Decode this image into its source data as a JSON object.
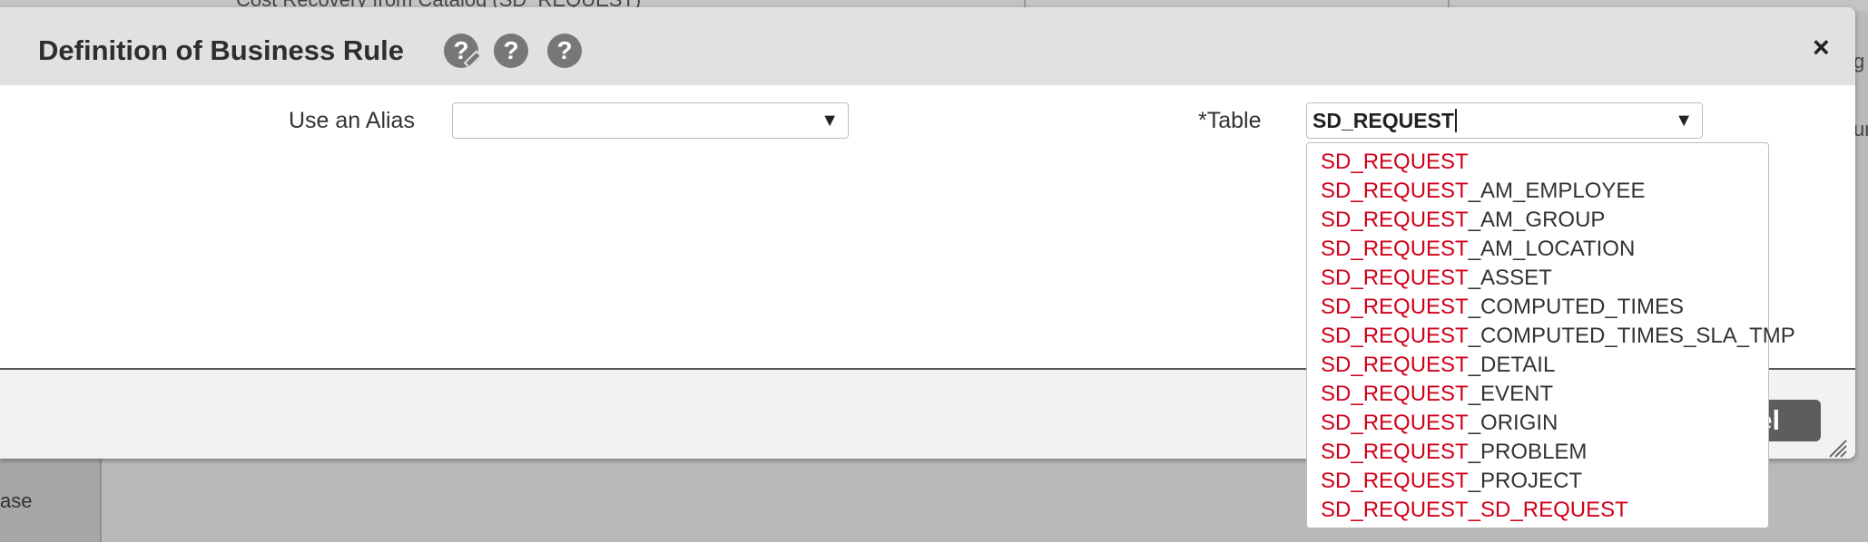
{
  "background": {
    "top_text": "Cost Recovery from Catalog (SD_REQUEST)",
    "left_text": "ase",
    "right_texts": [
      "g",
      "ur"
    ]
  },
  "modal": {
    "title": "Definition of Business Rule",
    "help_icons": [
      {
        "icon": "edit-help-icon",
        "glyph": "?"
      },
      {
        "icon": "help-icon",
        "glyph": "?"
      },
      {
        "icon": "help-icon",
        "glyph": "?"
      }
    ],
    "close_glyph": "×",
    "alias_label": "Use an Alias",
    "alias_value": "",
    "table_label": "*Table",
    "table_value": "SD_REQUEST",
    "select_arrow": "▼",
    "cancel_label": "Cancel",
    "cancel_visible": "cel"
  },
  "dropdown": {
    "match": "SD_REQUEST",
    "items": [
      {
        "match": "SD_REQUEST",
        "rest": ""
      },
      {
        "match": "SD_REQUEST",
        "rest": "_AM_EMPLOYEE"
      },
      {
        "match": "SD_REQUEST",
        "rest": "_AM_GROUP"
      },
      {
        "match": "SD_REQUEST",
        "rest": "_AM_LOCATION"
      },
      {
        "match": "SD_REQUEST",
        "rest": "_ASSET"
      },
      {
        "match": "SD_REQUEST",
        "rest": "_COMPUTED_TIMES"
      },
      {
        "match": "SD_REQUEST",
        "rest": "_COMPUTED_TIMES_SLA_TMP"
      },
      {
        "match": "SD_REQUEST",
        "rest": "_DETAIL"
      },
      {
        "match": "SD_REQUEST",
        "rest": "_EVENT"
      },
      {
        "match": "SD_REQUEST",
        "rest": "_ORIGIN"
      },
      {
        "match": "SD_REQUEST",
        "rest": "_PROBLEM"
      },
      {
        "match": "SD_REQUEST",
        "rest": "_PROJECT"
      },
      {
        "match": "SD_REQUEST",
        "rest": "_SD_REQUEST",
        "all_match": true
      }
    ]
  },
  "colors": {
    "match_red": "#d0021b",
    "header_gray": "#e1e1e1",
    "overlay_gray": "#b9b9b9",
    "button_gray": "#5d5d5d"
  }
}
